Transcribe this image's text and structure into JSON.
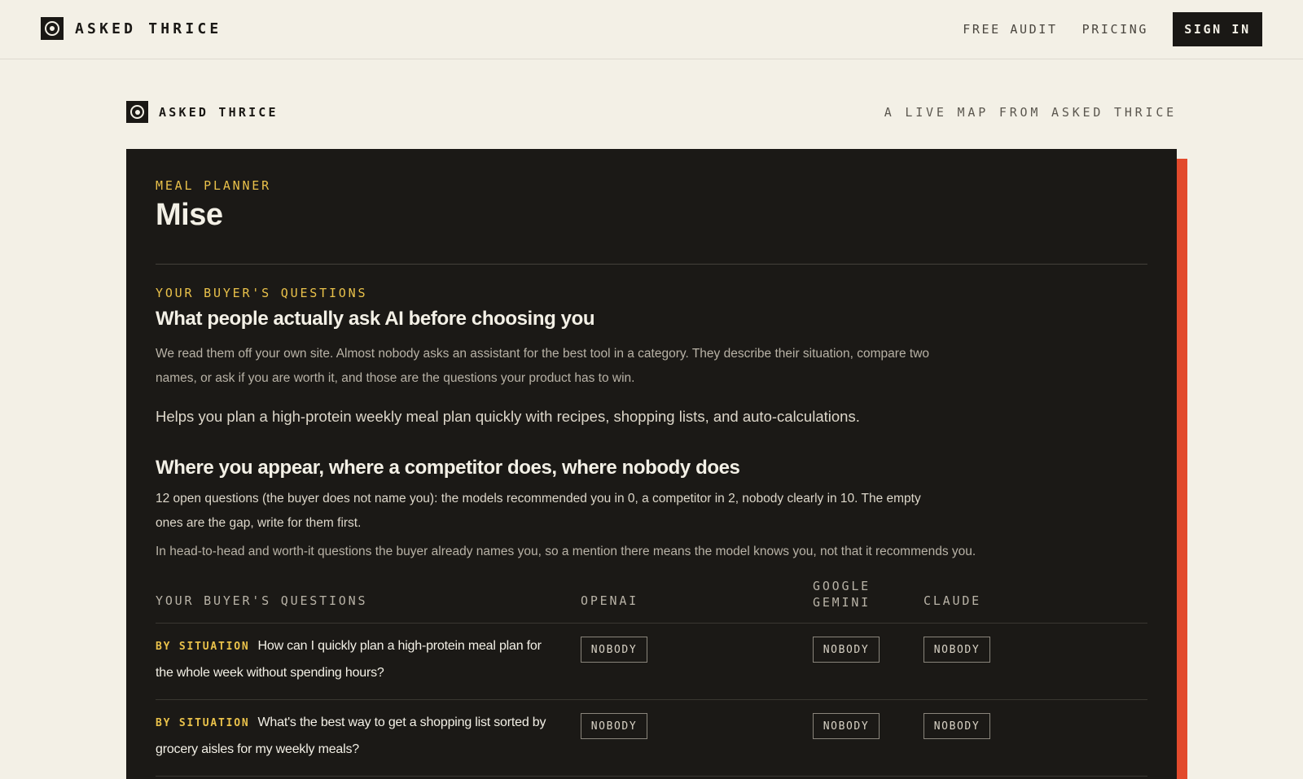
{
  "nav": {
    "brand": "ASKED THRICE",
    "links": [
      "FREE AUDIT",
      "PRICING"
    ],
    "signin": "SIGN IN"
  },
  "subheader": {
    "brand": "ASKED THRICE",
    "tagline": "A LIVE MAP FROM ASKED THRICE"
  },
  "product": {
    "category": "MEAL PLANNER",
    "name": "Mise"
  },
  "questions_section": {
    "kicker": "YOUR BUYER'S QUESTIONS",
    "heading": "What people actually ask AI before choosing you",
    "intro": "We read them off your own site. Almost nobody asks an assistant for the best tool in a category. They describe their situation, compare two names, or ask if you are worth it, and those are the questions your product has to win.",
    "description": "Helps you plan a high-protein weekly meal plan quickly with recipes, shopping lists, and auto-calculations."
  },
  "appearance_section": {
    "heading": "Where you appear, where a competitor does, where nobody does",
    "summary": "12 open questions (the buyer does not name you): the models recommended you in 0, a competitor in 2, nobody clearly in 10. The empty ones are the gap, write for them first.",
    "note": "In head-to-head and worth-it questions the buyer already names you, so a mention there means the model knows you, not that it recommends you."
  },
  "table": {
    "headers": [
      "YOUR BUYER'S QUESTIONS",
      "OPENAI",
      "GOOGLE GEMINI",
      "CLAUDE"
    ],
    "rows": [
      {
        "tag": "BY SITUATION",
        "question": "How can I quickly plan a high-protein meal plan for the whole week without spending hours?",
        "openai": "NOBODY",
        "gemini": "NOBODY",
        "claude": "NOBODY"
      },
      {
        "tag": "BY SITUATION",
        "question": "What's the best way to get a shopping list sorted by grocery aisles for my weekly meals?",
        "openai": "NOBODY",
        "gemini": "NOBODY",
        "claude": "NOBODY"
      }
    ]
  },
  "colors": {
    "background": "#f3f0e6",
    "panel": "#1b1916",
    "accent": "#e24a2c",
    "highlight": "#e9c14a"
  }
}
